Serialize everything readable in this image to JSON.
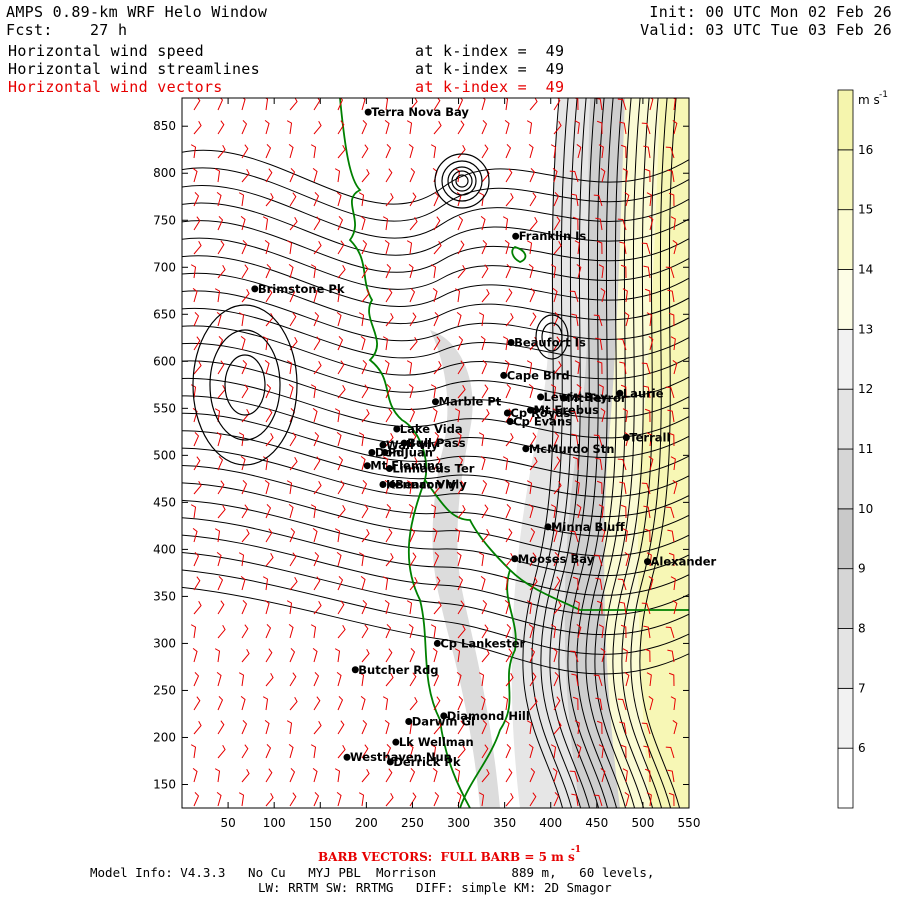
{
  "header": {
    "title": "AMPS 0.89-km WRF Helo Window",
    "forecast": "Fcst:    27 h",
    "init": "Init: 00 UTC Mon 02 Feb 26",
    "valid": "Valid: 03 UTC Tue 03 Feb 26",
    "fields": [
      {
        "name": "Horizontal wind speed",
        "level": "at k-index =  49"
      },
      {
        "name": "Horizontal wind streamlines",
        "level": "at k-index =  49"
      },
      {
        "name": "Horizontal wind vectors",
        "level": "at k-index =  49"
      }
    ]
  },
  "colorbar": {
    "units": "m s",
    "units_exp": "-1",
    "levels": [
      "6",
      "7",
      "8",
      "9",
      "10",
      "11",
      "12",
      "13",
      "14",
      "15",
      "16"
    ],
    "colors": [
      "#ffffff",
      "#f2f2f2",
      "#e4e4e4",
      "#d6d6d6",
      "#c9c9c9",
      "#d6d6d6",
      "#e4e4e4",
      "#f2f2f2",
      "#fdfde6",
      "#fbfbcf",
      "#f8f8bd",
      "#f5f5ad"
    ]
  },
  "footer": {
    "barb": "BARB VECTORS:  FULL BARB = 5 m s",
    "barb_exp": "-1",
    "line1": "Model Info: V4.3.3   No Cu   MYJ PBL  Morrison          889 m,   60 levels,",
    "line2": "LW: RRTM SW: RRTMG   DIFF: simple KM: 2D Smagor"
  },
  "accent": {
    "vectors": "#e60000",
    "coast": "#008000",
    "contours": "#000000"
  },
  "chart_data": {
    "type": "map",
    "x_ticks": [
      "50",
      "100",
      "150",
      "200",
      "250",
      "300",
      "350",
      "400",
      "450",
      "500",
      "550"
    ],
    "y_ticks": [
      "150",
      "200",
      "250",
      "300",
      "350",
      "400",
      "450",
      "500",
      "550",
      "600",
      "650",
      "700",
      "750",
      "800",
      "850"
    ],
    "xlim": [
      0,
      550
    ],
    "ylim": [
      125,
      880
    ],
    "stations": [
      {
        "name": "Terra Nova Bay",
        "x": 202,
        "y": 865
      },
      {
        "name": "Franklin Is",
        "x": 362,
        "y": 733
      },
      {
        "name": "Brimstone Pk",
        "x": 79,
        "y": 677
      },
      {
        "name": "Beaufort Is",
        "x": 357,
        "y": 620
      },
      {
        "name": "Cape Bird",
        "x": 349,
        "y": 585
      },
      {
        "name": "Lewis Bay",
        "x": 389,
        "y": 562
      },
      {
        "name": "Mt Terror",
        "x": 414,
        "y": 561
      },
      {
        "name": "Laurie",
        "x": 475,
        "y": 566
      },
      {
        "name": "Marble Pt",
        "x": 275,
        "y": 557
      },
      {
        "name": "Cp Royds",
        "x": 353,
        "y": 545
      },
      {
        "name": "Mt Erebus",
        "x": 378,
        "y": 548
      },
      {
        "name": "Lake Vida",
        "x": 233,
        "y": 528
      },
      {
        "name": "Cp Evans",
        "x": 356,
        "y": 536
      },
      {
        "name": "Terrall",
        "x": 482,
        "y": 519
      },
      {
        "name": "Wall Vly",
        "x": 218,
        "y": 511
      },
      {
        "name": "Bull Pass",
        "x": 241,
        "y": 513
      },
      {
        "name": "McMurdo Stn",
        "x": 373,
        "y": 507
      },
      {
        "name": "Don Juan",
        "x": 206,
        "y": 503
      },
      {
        "name": "Pd",
        "x": 220,
        "y": 503
      },
      {
        "name": "Mt Fleming",
        "x": 201,
        "y": 489
      },
      {
        "name": "Linnaeus Ter",
        "x": 225,
        "y": 486
      },
      {
        "name": "Kennar Vly",
        "x": 218,
        "y": 469
      },
      {
        "name": "Beacon Vly",
        "x": 228,
        "y": 469
      },
      {
        "name": "Minna Bluff",
        "x": 397,
        "y": 424
      },
      {
        "name": "Mooses Bay",
        "x": 361,
        "y": 390
      },
      {
        "name": "Alexander",
        "x": 505,
        "y": 387
      },
      {
        "name": "Cp Lankester",
        "x": 277,
        "y": 300
      },
      {
        "name": "Butcher Rdg",
        "x": 188,
        "y": 272
      },
      {
        "name": "Darwin Gl",
        "x": 246,
        "y": 217
      },
      {
        "name": "Diamond Hill",
        "x": 284,
        "y": 223
      },
      {
        "name": "Lk Wellman",
        "x": 232,
        "y": 195
      },
      {
        "name": "Westhaven Nun",
        "x": 179,
        "y": 179
      },
      {
        "name": "Derrick Pk",
        "x": 226,
        "y": 174
      }
    ]
  }
}
